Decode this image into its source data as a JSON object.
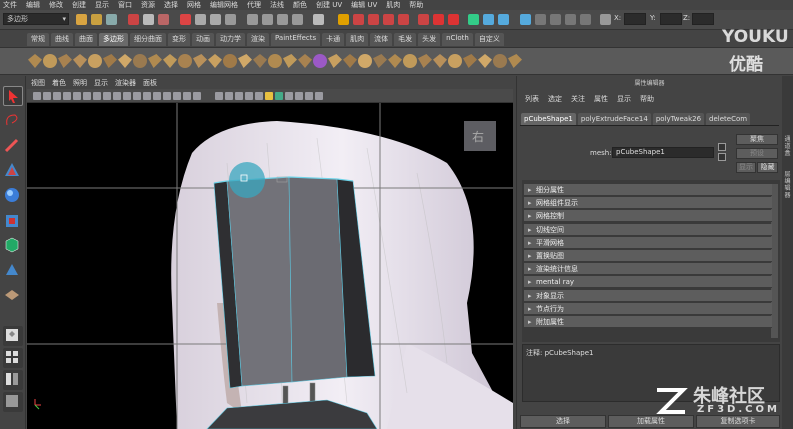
{
  "menubar": [
    "文件",
    "编辑",
    "修改",
    "创建",
    "显示",
    "窗口",
    "资源",
    "选择",
    "网格",
    "编辑网格",
    "代理",
    "法线",
    "颜色",
    "创建 UV",
    "编辑 UV",
    "肌肉",
    "帮助"
  ],
  "status": {
    "mode": "多边形",
    "x_label": "X:",
    "y_label": "Y:",
    "z_label": "Z:"
  },
  "shelf_tabs": [
    "常规",
    "曲线",
    "曲面",
    "多边形",
    "细分曲面",
    "变形",
    "动画",
    "动力学",
    "渲染",
    "PaintEffects",
    "卡通",
    "肌肉",
    "流体",
    "毛发",
    "头发",
    "nCloth",
    "自定义"
  ],
  "shelf_active": "多边形",
  "viewport": {
    "menu": [
      "视图",
      "着色",
      "照明",
      "显示",
      "渲染器",
      "面板"
    ],
    "grid_color": "#7a7a7a",
    "selection_color": "#6fd3e8"
  },
  "panel": {
    "title": "属性编辑器",
    "menu": [
      "列表",
      "选定",
      "关注",
      "属性",
      "显示",
      "帮助"
    ],
    "tabs": [
      "pCubeShape1",
      "polyExtrudeFace14",
      "polyTweak26",
      "deleteCom"
    ],
    "mesh_label": "mesh:",
    "mesh_value": "pCubeShape1",
    "focus_btn": "聚焦",
    "preset_btn": "预设",
    "show_btn": "显示",
    "hide_btn": "隐藏",
    "sections": [
      "细分属性",
      "网格组件显示",
      "网格控制",
      "切线空间",
      "平滑网格",
      "置换贴图",
      "渲染统计信息",
      "mental ray",
      "对象显示",
      "节点行为",
      "附加属性"
    ],
    "note": "注释: pCubeShape1",
    "bottom": [
      "选择",
      "加载属性",
      "复制选项卡"
    ]
  },
  "right_side": [
    "通道盒",
    "层编辑器"
  ],
  "watermarks": {
    "youku": "YOUKU",
    "youku_cn": "优酷",
    "zf": "朱峰社区",
    "zf_url": "ZF3D.COM"
  }
}
